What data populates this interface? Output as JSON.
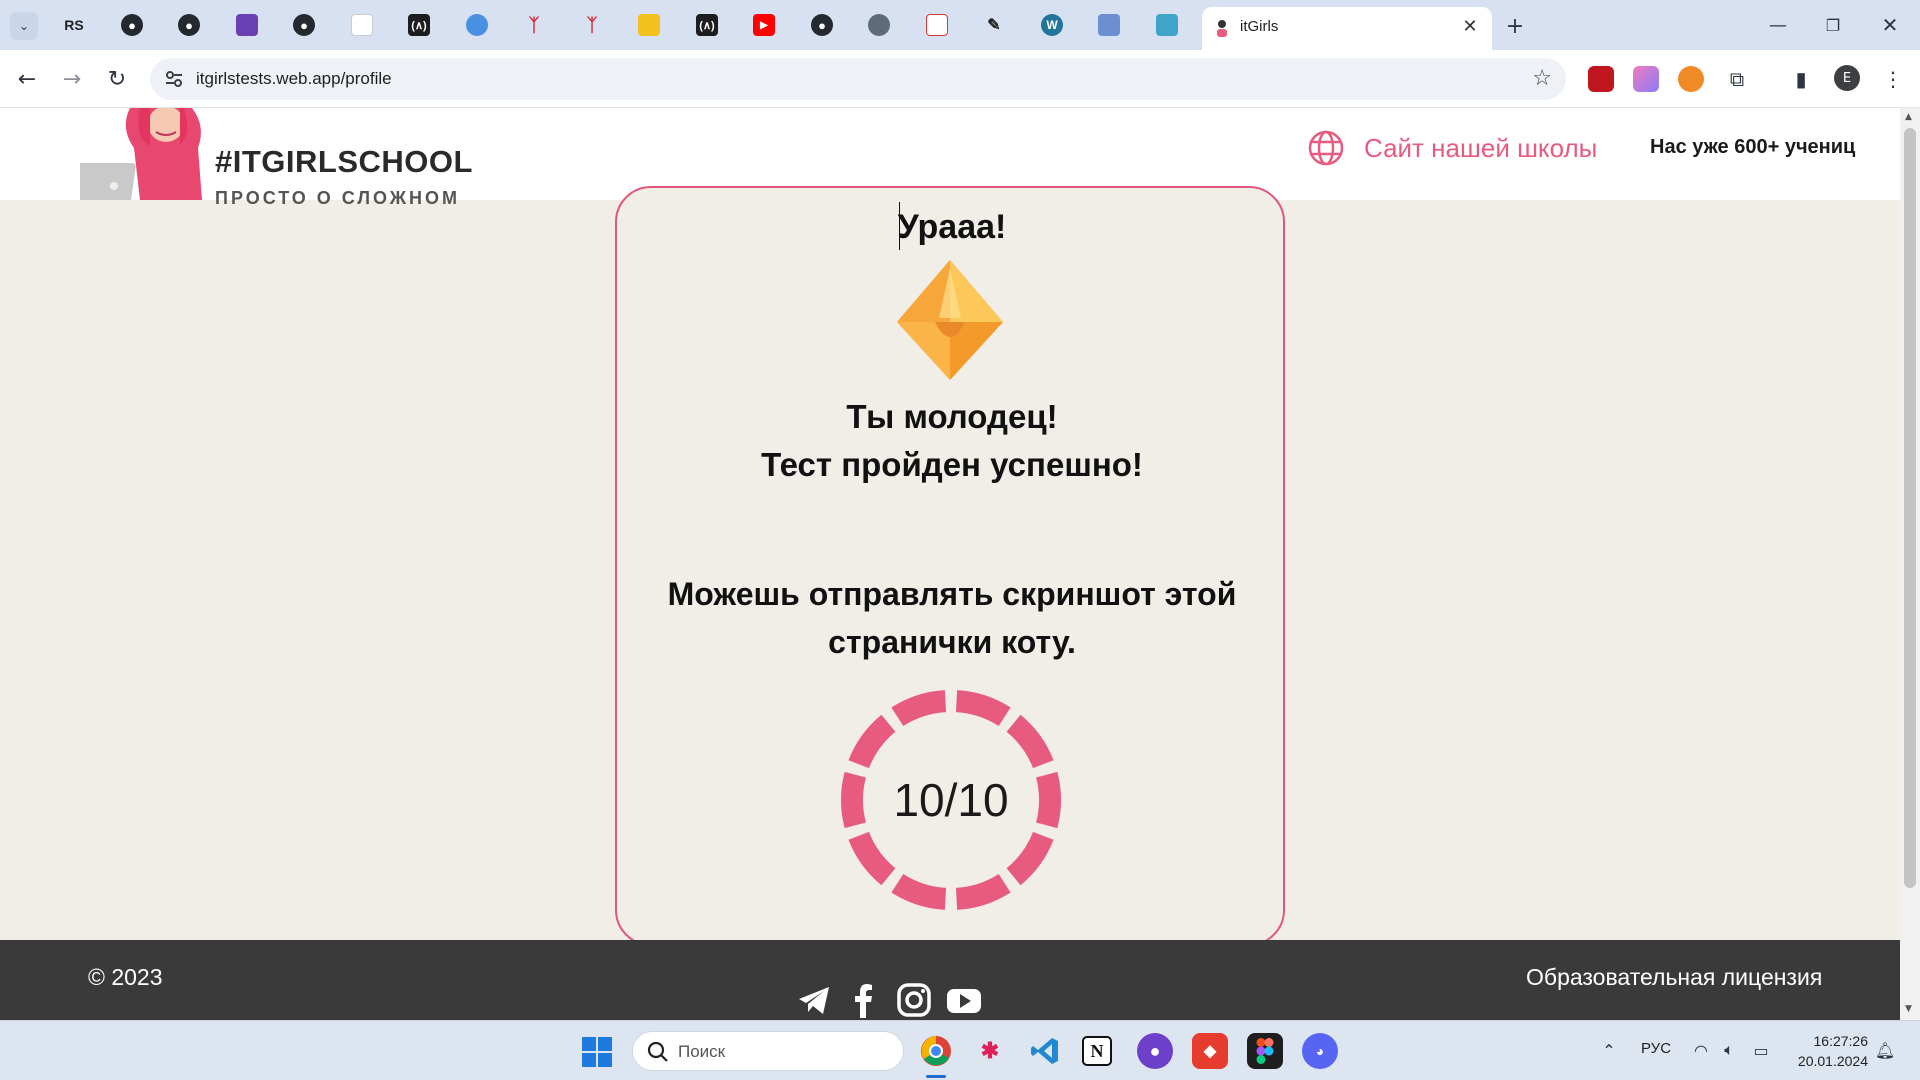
{
  "browser": {
    "active_tab_title": "itGirls",
    "url": "itgirlstests.web.app/profile",
    "profile_initial": "E"
  },
  "header": {
    "logo_title": "#ITGIRLSCHOOL",
    "logo_subtitle": "ПРОСТО О СЛОЖНОМ",
    "school_link": "Сайт нашей школы",
    "students_count": "Нас уже 600+ учениц"
  },
  "result": {
    "heading": "Урааа!",
    "congrats_line1": "Ты молодец!",
    "congrats_line2": "Тест пройден успешно!",
    "send_text": "Можешь отправлять скриншот этой странички коту.",
    "score": "10/10",
    "score_fraction": 1.0,
    "accent_color": "#e85b81"
  },
  "footer": {
    "copyright": "© 2023",
    "license": "Образовательная лицензия",
    "socials": [
      "telegram-icon",
      "facebook-icon",
      "instagram-icon",
      "youtube-icon"
    ]
  },
  "taskbar": {
    "search_placeholder": "Поиск",
    "language": "РУС",
    "time": "16:27:26",
    "date": "20.01.2024"
  }
}
